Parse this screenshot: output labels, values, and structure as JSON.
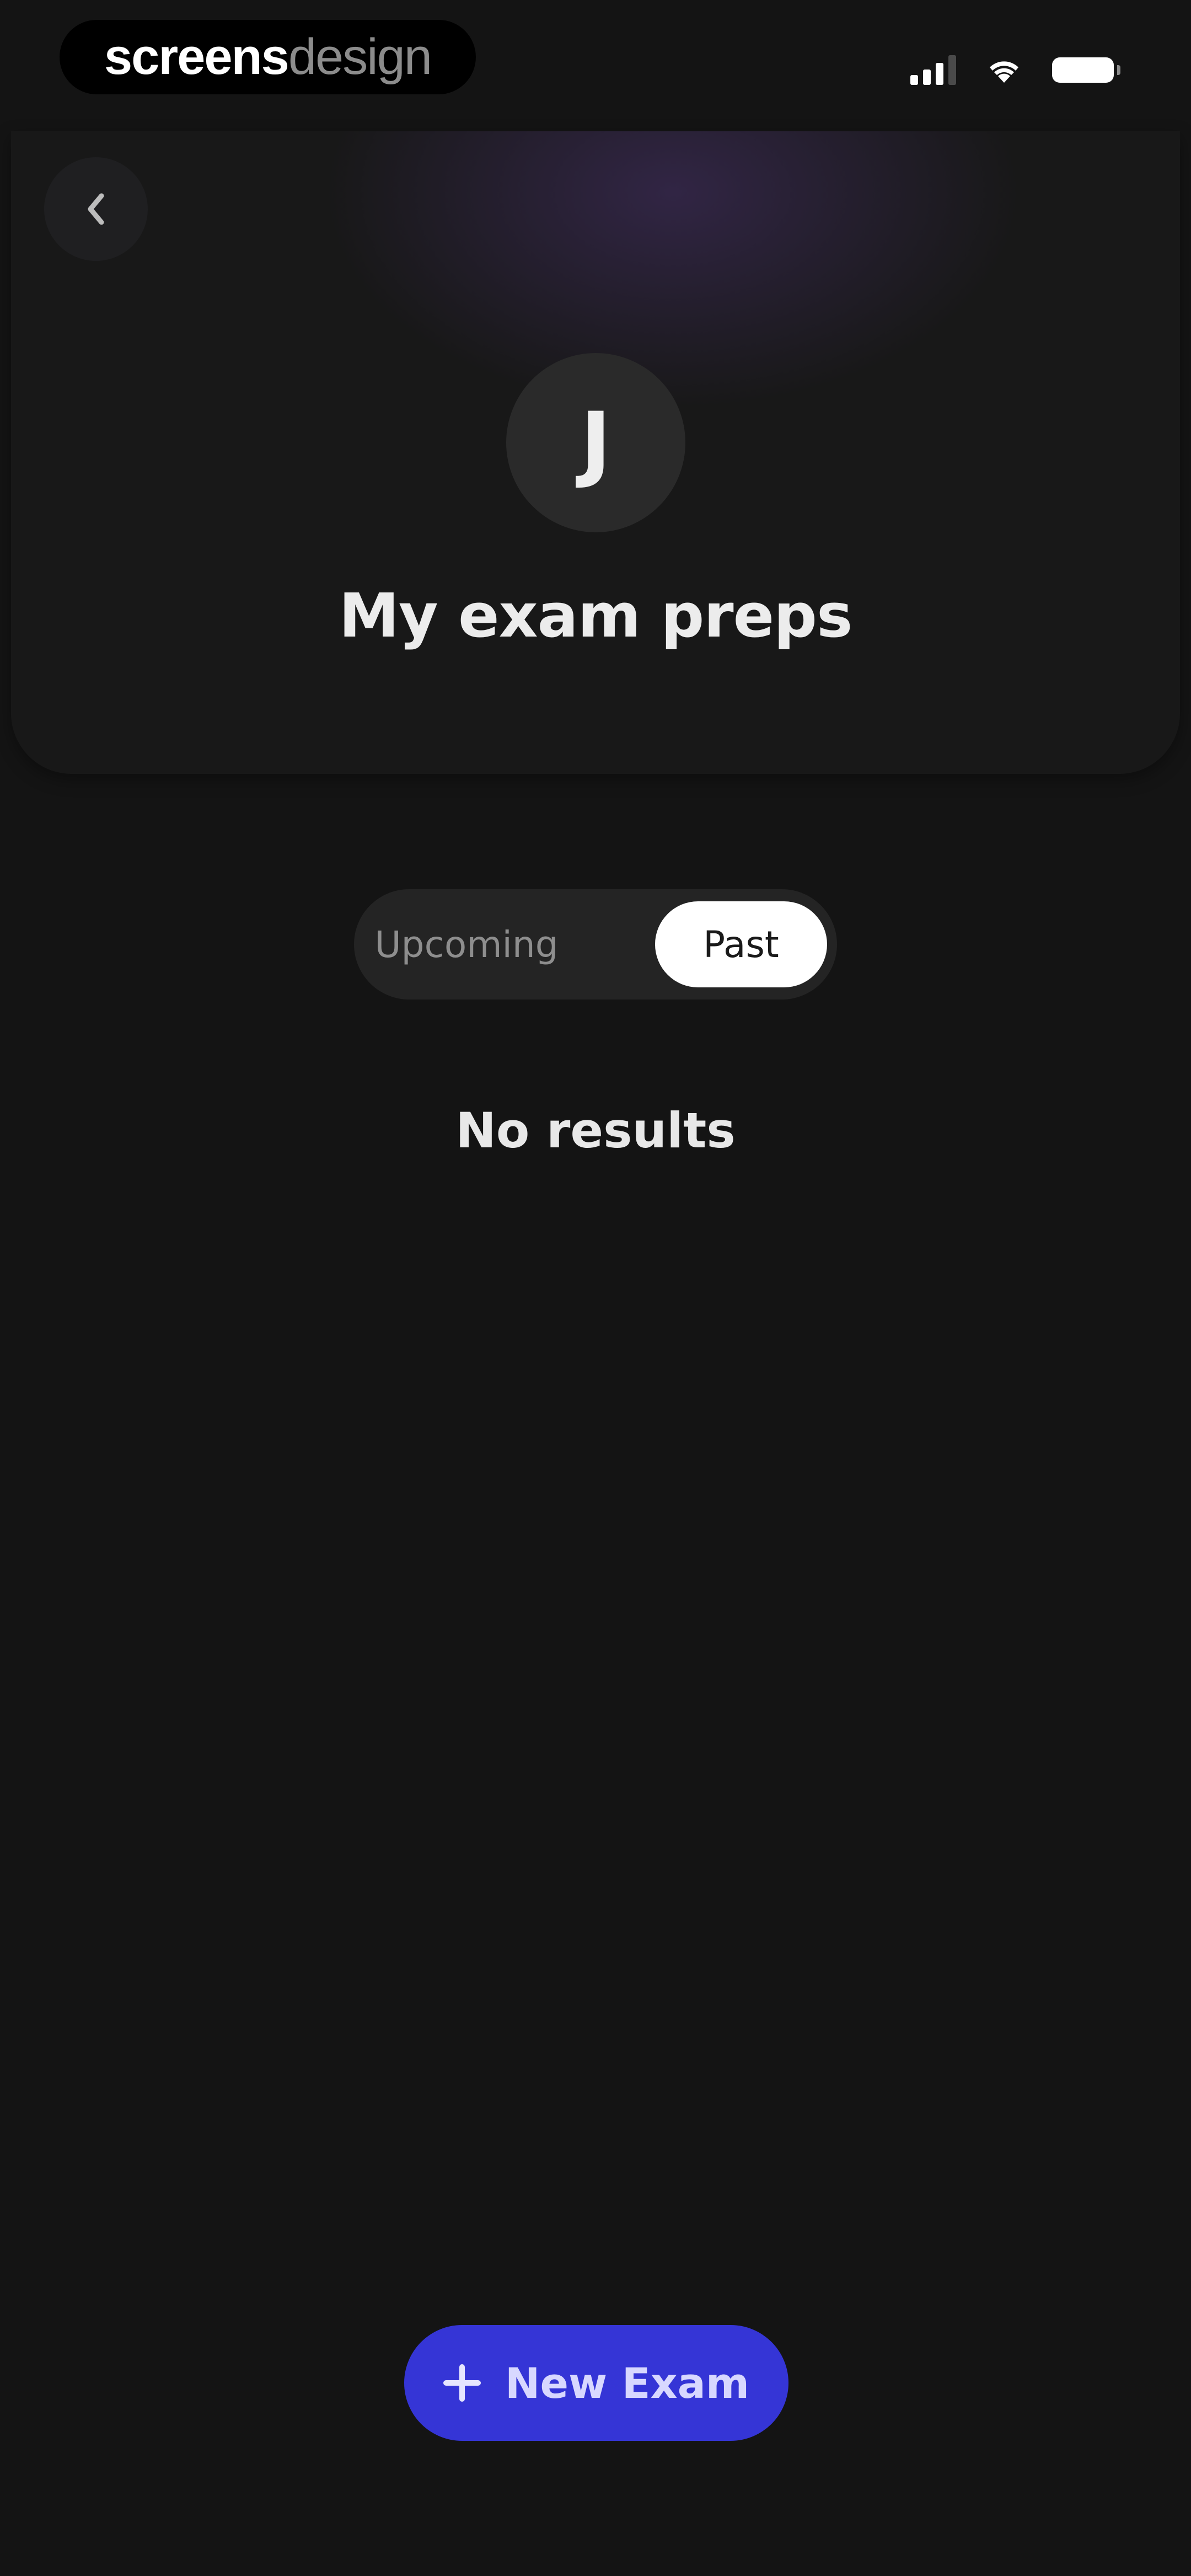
{
  "brand": {
    "part1": "screens",
    "part2": "design"
  },
  "header": {
    "avatar_initial": "J",
    "title": "My exam preps"
  },
  "tabs": {
    "items": [
      {
        "label": "Upcoming",
        "selected": false
      },
      {
        "label": "Past",
        "selected": true
      }
    ]
  },
  "content": {
    "empty_message": "No results"
  },
  "actions": {
    "new_exam_label": "New Exam"
  },
  "icons": {
    "back": "chevron-left-icon",
    "add": "plus-icon",
    "signal": "cellular-signal-icon",
    "wifi": "wifi-icon",
    "battery": "battery-icon"
  },
  "colors": {
    "background": "#141414",
    "accent": "#3535d6",
    "tab_selected_bg": "#ffffff",
    "header_glow": "#463069"
  }
}
